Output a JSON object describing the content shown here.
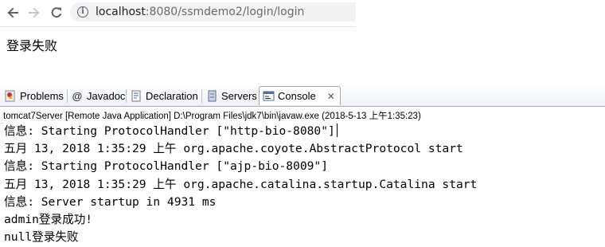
{
  "browser": {
    "url_host": "localhost",
    "url_rest": ":8080/ssmdemo2/login/login",
    "page_message": "登录失败"
  },
  "eclipse": {
    "tabs": [
      {
        "label": "Problems",
        "icon": "problems-icon"
      },
      {
        "label": "Javadoc",
        "icon": "at-icon"
      },
      {
        "label": "Declaration",
        "icon": "declaration-icon"
      },
      {
        "label": "Servers",
        "icon": "servers-icon"
      },
      {
        "label": "Console",
        "icon": "console-icon",
        "close": "✕",
        "active": true
      }
    ],
    "console_title": "tomcat7Server [Remote Java Application] D:\\Program Files\\jdk7\\bin\\javaw.exe (2018-5-13 上午1:35:23)",
    "console_lines": [
      "信息: Starting ProtocolHandler [\"http-bio-8080\"]",
      "五月 13, 2018 1:35:29 上午 org.apache.coyote.AbstractProtocol start",
      "信息: Starting ProtocolHandler [\"ajp-bio-8009\"]",
      "五月 13, 2018 1:35:29 上午 org.apache.catalina.startup.Catalina start",
      "信息: Server startup in 4931 ms",
      "admin登录成功!",
      "null登录失败"
    ]
  },
  "colors": {
    "console_text": "#000000",
    "tab_border": "#a0a9b8",
    "url_host": "#202124",
    "url_path": "#6b6b6b"
  }
}
